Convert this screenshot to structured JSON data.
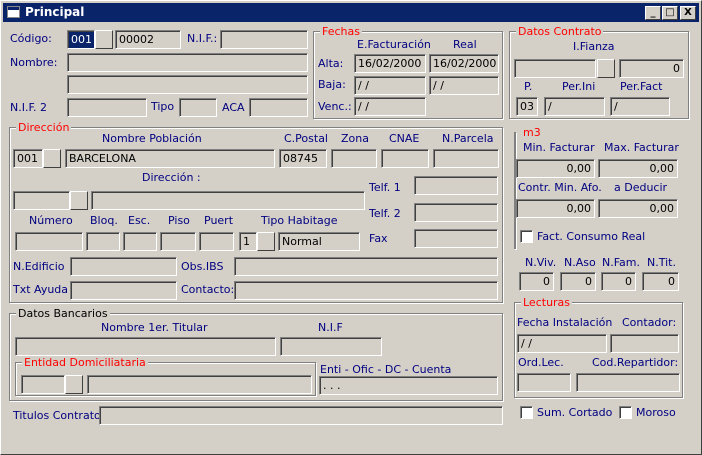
{
  "window": {
    "title": "Principal",
    "min": "_",
    "max": "□",
    "close": "X"
  },
  "general": {
    "codigo_label": "Código:",
    "codigo_value": "001",
    "codigo_value2": "00002",
    "nif_label": "N.I.F.:",
    "nombre_label": "Nombre:",
    "nif2_label": "N.I.F. 2",
    "tipo_label": "Tipo",
    "aca_label": "ACA"
  },
  "fechas": {
    "title": "Fechas",
    "efact_label": "E.Facturación",
    "real_label": "Real",
    "alta_label": "Alta:",
    "alta_efact": "16/02/2000",
    "alta_real": "16/02/2000",
    "baja_label": "Baja:",
    "baja_efact": " / /",
    "baja_real": " / /",
    "venc_label": "Venc.:",
    "venc_efact": " / /"
  },
  "contrato": {
    "title": "Datos Contrato",
    "fianza_label": "I.Fianza",
    "fianza_value": "0",
    "p_label": "P.",
    "p_value": "03",
    "perini_label": "Per.Ini",
    "perini_value": " /",
    "perfact_label": "Per.Fact",
    "perfact_value": " /"
  },
  "direccion": {
    "title": "Dirección",
    "poblacion_label": "Nombre Población",
    "poblacion_code": "001",
    "poblacion_value": "BARCELONA",
    "cpostal_label": "C.Postal",
    "cpostal_value": "08745",
    "zona_label": "Zona",
    "cnae_label": "CNAE",
    "parcela_label": "N.Parcela",
    "direccion_label": "Dirección :",
    "telf1_label": "Telf. 1",
    "telf2_label": "Telf. 2",
    "numero_label": "Número",
    "bloq_label": "Bloq.",
    "esc_label": "Esc.",
    "piso_label": "Piso",
    "puert_label": "Puert",
    "tipohab_label": "Tipo Habitage",
    "tipohab_code": "1",
    "tipohab_value": "Normal",
    "fax_label": "Fax",
    "edificio_label": "N.Edificio",
    "obsibs_label": "Obs.IBS",
    "txtayuda_label": "Txt Ayuda",
    "contacto_label": "Contacto:"
  },
  "m3": {
    "title": "m3",
    "minfact_label": "Min. Facturar",
    "maxfact_label": "Max. Facturar",
    "minfact_value": "0,00",
    "maxfact_value": "0,00",
    "contrmin_label": "Contr. Min. Afo.",
    "deducir_label": "a Deducir",
    "contrmin_value": "0,00",
    "deducir_value": "0,00",
    "consumo_label": "Fact. Consumo Real"
  },
  "counts": {
    "nviv_label": "N.Viv.",
    "naso_label": "N.Aso",
    "nfam_label": "N.Fam.",
    "ntit_label": "N.Tit.",
    "nviv_value": "0",
    "naso_value": "0",
    "nfam_value": "0",
    "ntit_value": "0"
  },
  "lecturas": {
    "title": "Lecturas",
    "fecha_label": "Fecha Instalación",
    "fecha_value": " / /",
    "contador_label": "Contador:",
    "ordlec_label": "Ord.Lec.",
    "codrep_label": "Cod.Repartidor:",
    "sumcortado_label": "Sum. Cortado",
    "moroso_label": "Moroso"
  },
  "bancarios": {
    "title": "Datos Bancarios",
    "titular_label": "Nombre 1er. Titular",
    "nif_label": "N.I.F",
    "entidad_title": "Entidad Domiciliataria",
    "cuenta_label": "Enti - Ofic - DC - Cuenta",
    "cuenta_value": "   .   .   ."
  },
  "titulos_label": "Titulos Contrato"
}
